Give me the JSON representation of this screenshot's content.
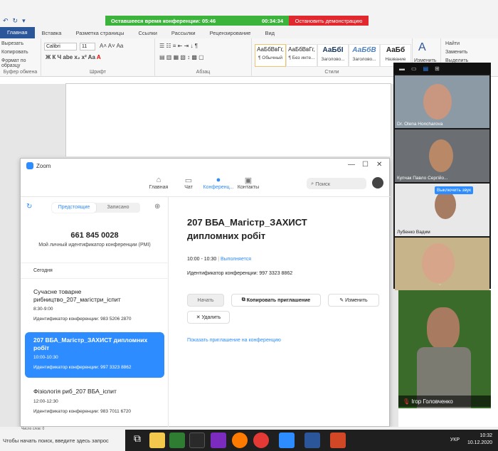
{
  "word": {
    "conf_timer_label": "Оставшееся время конференции: 05:46",
    "conf_elapsed": "00:34:34",
    "stop_demo": "Остановить демонстрацию",
    "tabs": [
      "Главная",
      "Вставка",
      "Разметка страницы",
      "Ссылки",
      "Рассылки",
      "Рецензирование",
      "Вид"
    ],
    "clipboard_items": [
      "Вырезать",
      "Копировать",
      "Формат по образцу"
    ],
    "clipboard_label": "Буфер обмена",
    "font_name": "Calibri",
    "font_size": "11",
    "font_group_label": "Шрифт",
    "para_group_label": "Абзац",
    "styles_group_label": "Стили",
    "styles": [
      {
        "preview": "АаБбВвГг,",
        "name": "¶ Обычный"
      },
      {
        "preview": "АаБбВвГг,",
        "name": "¶ Без инте..."
      },
      {
        "preview": "АаБбI",
        "name": "Заголово..."
      },
      {
        "preview": "АаБбВ",
        "name": "Заголово..."
      },
      {
        "preview": "АаБб",
        "name": "Название"
      }
    ],
    "change_styles": "Изменить",
    "edit_items": [
      "Найти",
      "Заменить",
      "Выделить"
    ],
    "status_left": "Число слов: 0"
  },
  "zoom": {
    "title": "Zoom",
    "nav": [
      {
        "label": "Главная",
        "icon": "home-icon"
      },
      {
        "label": "Чат",
        "icon": "chat-icon"
      },
      {
        "label": "Конференц...",
        "icon": "clock-icon"
      },
      {
        "label": "Контакты",
        "icon": "contacts-icon"
      }
    ],
    "search_placeholder": "Поиск",
    "segments": [
      "Предстоящие",
      "Записано"
    ],
    "pmi_number": "661 845 0028",
    "pmi_caption": "Мой личный идентификатор конференции (PMI)",
    "today_label": "Сегодня",
    "meetings": [
      {
        "title": "Сучасне товарне рибництво_207_магістри_іспит",
        "time": "8:30-9:00",
        "id": "Идентификатор конференции: 983 5206 2870"
      },
      {
        "title": "207 ВБА_Магістр_ЗАХИСТ дипломних робіт",
        "time": "10:00-10:30",
        "id": "Идентификатор конференции: 997 3323 8862"
      },
      {
        "title": "Фізіологія риб_207 ВБА_іспит",
        "time": "12:00-12:30",
        "id": "Идентификатор конференции: 983 7011 6720"
      }
    ],
    "detail": {
      "title": "207 ВБА_Магістр_ЗАХИСТ дипломних робіт",
      "time": "10:00 - 10:30",
      "status": "Выполняется",
      "id_line": "Идентификатор конференции: 997 3323 8862",
      "start": "Начать",
      "copy_invite": "Копировать приглашение",
      "edit": "Изменить",
      "delete": "Удалить",
      "show_invite": "Показать приглашение на конференцию"
    }
  },
  "gallery": {
    "participants": [
      "Dr. Olena Honcharova",
      "Купчак Павло Сергійо...",
      "Лубенко Вадим",
      ""
    ],
    "unmute_tooltip": "Выключить звук",
    "speaker": "Ігор Головченко"
  },
  "taskbar": {
    "search_placeholder": "Чтобы начать поиск, введите здесь запрос",
    "lang": "УКР",
    "time": "10:32",
    "date": "10.12.2020"
  }
}
